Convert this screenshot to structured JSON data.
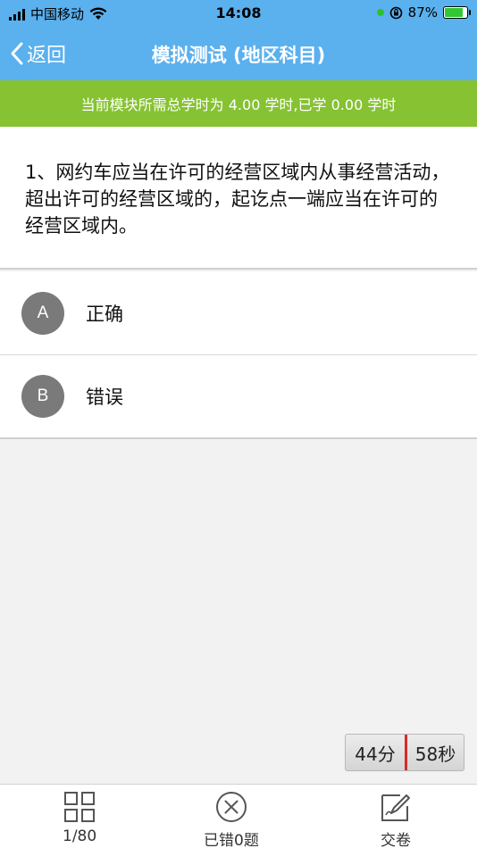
{
  "status_bar": {
    "carrier": "中国移动",
    "time": "14:08",
    "battery_percent": "87%",
    "battery_level": 0.87,
    "icons": [
      "signal-icon",
      "wifi-icon",
      "location-icon",
      "orientation-lock-icon",
      "battery-charging-icon"
    ]
  },
  "nav": {
    "back_label": "返回",
    "title": "模拟测试 (地区科目)"
  },
  "info_strip": {
    "text": "当前模块所需总学时为 4.00 学时,已学 0.00 学时"
  },
  "question": {
    "text": "1、网约车应当在许可的经营区域内从事经营活动，超出许可的经营区域的，起讫点一端应当在许可的经营区域内。"
  },
  "options": [
    {
      "letter": "A",
      "text": "正确"
    },
    {
      "letter": "B",
      "text": "错误"
    }
  ],
  "timer": {
    "minutes": "44分",
    "seconds": "58秒"
  },
  "bottom_bar": {
    "progress_label": "1/80",
    "wrong_label": "已错0题",
    "submit_label": "交卷"
  },
  "colors": {
    "header_blue": "#5bb0ee",
    "info_green": "#86c232",
    "badge_gray": "#7a7a7a"
  }
}
